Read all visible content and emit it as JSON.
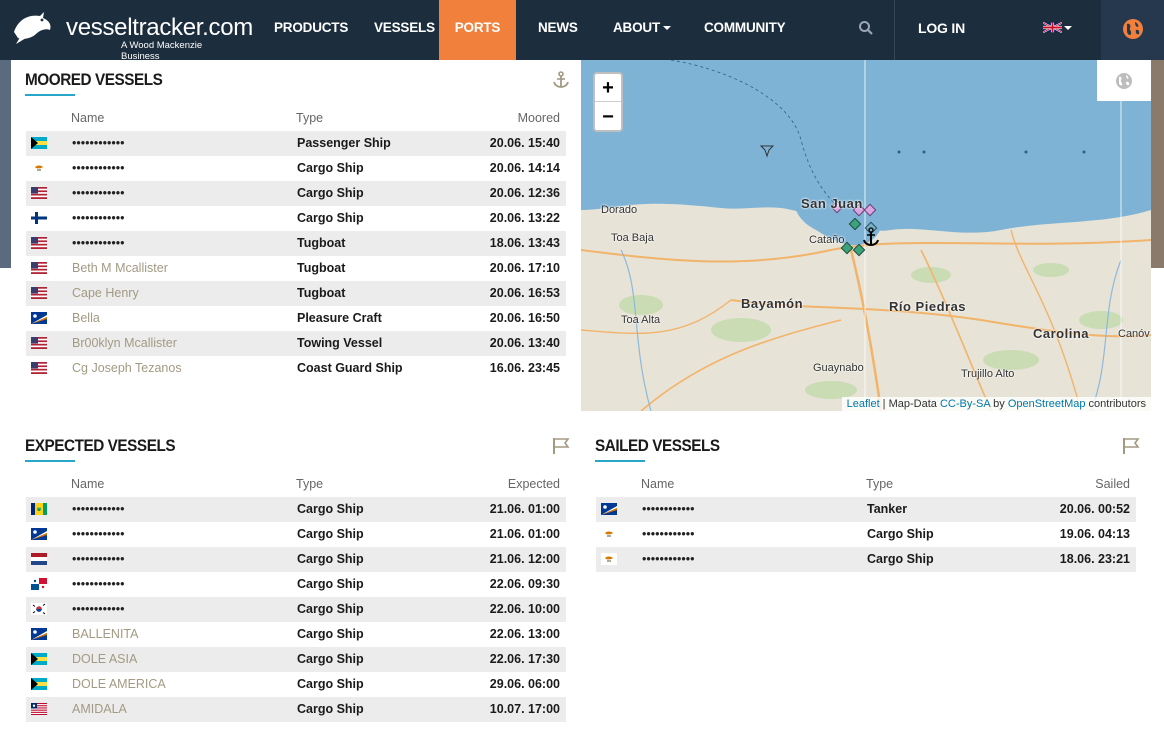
{
  "brand": {
    "name": "vesseltracker.com",
    "tagline": "A Wood Mackenzie Business"
  },
  "nav": {
    "items": [
      {
        "label": "PRODUCTS"
      },
      {
        "label": "VESSELS"
      },
      {
        "label": "PORTS"
      },
      {
        "label": "NEWS"
      },
      {
        "label": "ABOUT"
      },
      {
        "label": "COMMUNITY"
      }
    ],
    "active": "PORTS",
    "login_label": "LOG IN",
    "language_flag": "uk-flag-icon",
    "accent_color": "#f0803c",
    "nav_bg": "#1c2d3d"
  },
  "moored": {
    "title": "MOORED VESSELS",
    "icon": "anchor-icon",
    "columns": {
      "name": "Name",
      "type": "Type",
      "time": "Moored"
    },
    "rows": [
      {
        "flag": "bahamas",
        "name": "••••••••••••",
        "type": "Passenger Ship",
        "time": "20.06. 15:40"
      },
      {
        "flag": "cyprus",
        "name": "••••••••••••",
        "type": "Cargo Ship",
        "time": "20.06. 14:14"
      },
      {
        "flag": "usa",
        "name": "••••••••••••",
        "type": "Cargo Ship",
        "time": "20.06. 12:36"
      },
      {
        "flag": "finland",
        "name": "••••••••••••",
        "type": "Cargo Ship",
        "time": "20.06. 13:22"
      },
      {
        "flag": "usa",
        "name": "••••••••••••",
        "type": "Tugboat",
        "time": "18.06. 13:43"
      },
      {
        "flag": "usa",
        "name": "Beth M Mcallister",
        "type": "Tugboat",
        "time": "20.06. 17:10"
      },
      {
        "flag": "usa",
        "name": "Cape Henry",
        "type": "Tugboat",
        "time": "20.06. 16:53"
      },
      {
        "flag": "marshall",
        "name": "Bella",
        "type": "Pleasure Craft",
        "time": "20.06. 16:50"
      },
      {
        "flag": "usa",
        "name": "Br00klyn Mcallister",
        "type": "Towing Vessel",
        "time": "20.06. 13:40"
      },
      {
        "flag": "usa",
        "name": "Cg Joseph Tezanos",
        "type": "Coast Guard Ship",
        "time": "16.06. 23:45"
      }
    ]
  },
  "expected": {
    "title": "EXPECTED VESSELS",
    "icon": "flag-icon",
    "columns": {
      "name": "Name",
      "type": "Type",
      "time": "Expected"
    },
    "rows": [
      {
        "flag": "stvincent",
        "name": "••••••••••••",
        "type": "Cargo Ship",
        "time": "21.06. 01:00"
      },
      {
        "flag": "marshall",
        "name": "••••••••••••",
        "type": "Cargo Ship",
        "time": "21.06. 01:00"
      },
      {
        "flag": "netherlands",
        "name": "••••••••••••",
        "type": "Cargo Ship",
        "time": "21.06. 12:00"
      },
      {
        "flag": "panama",
        "name": "••••••••••••",
        "type": "Cargo Ship",
        "time": "22.06. 09:30"
      },
      {
        "flag": "korea",
        "name": "••••••••••••",
        "type": "Cargo Ship",
        "time": "22.06. 10:00"
      },
      {
        "flag": "marshall",
        "name": "BALLENITA",
        "type": "Cargo Ship",
        "time": "22.06. 13:00"
      },
      {
        "flag": "bahamas",
        "name": "DOLE ASIA",
        "type": "Cargo Ship",
        "time": "22.06. 17:30"
      },
      {
        "flag": "bahamas",
        "name": "DOLE AMERICA",
        "type": "Cargo Ship",
        "time": "29.06. 06:00"
      },
      {
        "flag": "liberia",
        "name": "AMIDALA",
        "type": "Cargo Ship",
        "time": "10.07. 17:00"
      }
    ]
  },
  "sailed": {
    "title": "SAILED VESSELS",
    "icon": "flag-icon",
    "columns": {
      "name": "Name",
      "type": "Type",
      "time": "Sailed"
    },
    "rows": [
      {
        "flag": "marshall",
        "name": "••••••••••••",
        "type": "Tanker",
        "time": "20.06. 00:52"
      },
      {
        "flag": "cyprus",
        "name": "••••••••••••",
        "type": "Cargo Ship",
        "time": "19.06. 04:13"
      },
      {
        "flag": "cyprus",
        "name": "••••••••••••",
        "type": "Cargo Ship",
        "time": "18.06. 23:21"
      }
    ]
  },
  "map": {
    "zoom_in": "+",
    "zoom_out": "−",
    "labels": {
      "dorado": "Dorado",
      "toa_baja": "Toa Baja",
      "san_juan": "San Juan",
      "catano": "Cataño",
      "bayamon": "Bayamón",
      "rio_piedras": "Río Piedras",
      "toa_alta": "Toa Alta",
      "carolina": "Carolina",
      "canov": "Canóv",
      "guaynabo": "Guaynabo",
      "trujillo_alto": "Trujillo Alto"
    },
    "attribution": {
      "leaflet": "Leaflet",
      "sep": " | Map-Data ",
      "license": "CC-By-SA",
      "by": " by ",
      "osm": "OpenStreetMap",
      "contrib": " contributors"
    }
  }
}
